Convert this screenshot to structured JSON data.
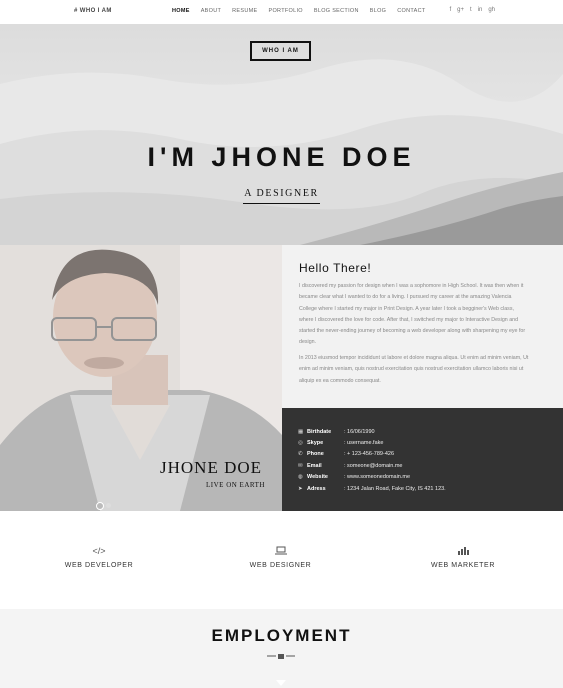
{
  "nav": {
    "brand": "# WHO I AM",
    "items": [
      "HOME",
      "ABOUT",
      "RESUME",
      "PORTFOLIO",
      "BLOG SECTION",
      "BLOG",
      "CONTACT"
    ],
    "social": [
      "f",
      "g+",
      "t",
      "in",
      "gh"
    ]
  },
  "hero": {
    "button": "WHO I AM",
    "title": "I'M JHONE DOE",
    "subtitle": "A DESIGNER"
  },
  "profile": {
    "name": "JHONE DOE",
    "tagline": "LIVE ON EARTH"
  },
  "about": {
    "heading": "Hello There!",
    "p1": "I discovered my passion for design when I was a sophomore in High School. It was then when it became clear what I wanted to do for a living. I pursued my career at the amazing Valencia College where I started my major in Print Design. A year later I took a begginer's Web class, where I discovered the love for code. After that, I switched my major to Interactive Design and started the never-ending journey of becoming a web developer along with sharpening my eye for design.",
    "p2": "In 2013 eiusmod tempor incididunt ut labore et dolore magna aliqua. Ut enim ad minim veniam, Ut enim ad minim veniam, quis nostrud exercitation quis nostrud exercitation ullamco laboris nisi ut aliquip ex ea commodo consequat."
  },
  "details": [
    {
      "icon": "calendar-icon",
      "label": "Birthdate",
      "value": ": 16/06/1990"
    },
    {
      "icon": "skype-icon",
      "label": "Skype",
      "value": ": username.fake"
    },
    {
      "icon": "phone-icon",
      "label": "Phone",
      "value": ": + 123-456-789-426"
    },
    {
      "icon": "email-icon",
      "label": "Email",
      "value": ": someone@domain.me"
    },
    {
      "icon": "globe-icon",
      "label": "Website",
      "value": ": www.someonedomain.me"
    },
    {
      "icon": "location-icon",
      "label": "Adress",
      "value": ": 1234 Jalan Road, Fake City, IS 421 123."
    }
  ],
  "services": [
    {
      "icon": "code-icon",
      "title": "WEB DEVELOPER"
    },
    {
      "icon": "laptop-icon",
      "title": "WEB DESIGNER"
    },
    {
      "icon": "bar-chart-icon",
      "title": "WEB MARKETER"
    }
  ],
  "employment": {
    "title": "EMPLOYMENT"
  }
}
